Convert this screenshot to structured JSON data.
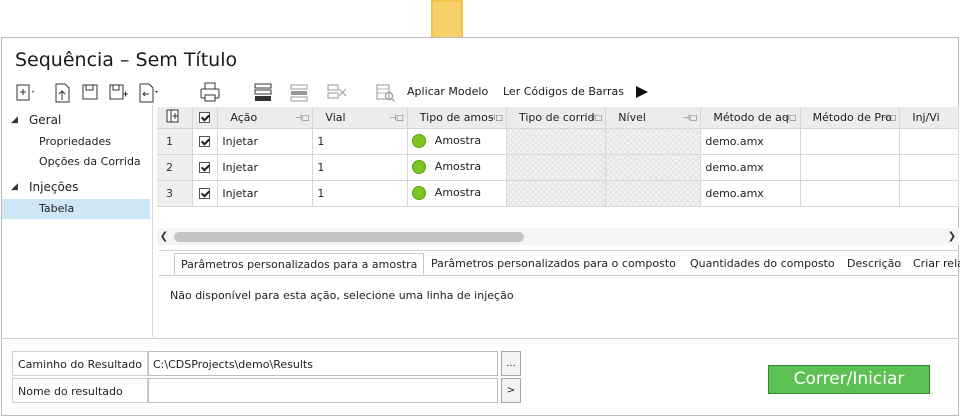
{
  "window": {
    "title": "Sequência – Sem Título"
  },
  "toolbar": {
    "apply_template": "Aplicar Modelo",
    "read_barcodes": "Ler Códigos de Barras"
  },
  "nav": {
    "groups": [
      {
        "label": "Geral",
        "items": [
          "Propriedades",
          "Opções da Corrida"
        ]
      },
      {
        "label": "Injeções",
        "items": [
          "Tabela"
        ]
      }
    ],
    "selected": "Tabela"
  },
  "grid": {
    "columns": [
      "Ação",
      "Vial",
      "Tipo de amos",
      "Tipo de corrid",
      "Nível",
      "Método de aq",
      "Método de Pro",
      "Inj/Vi"
    ],
    "rows": [
      {
        "num": "1",
        "checked": true,
        "action": "Injetar",
        "vial": "1",
        "sample_type": "Amostra",
        "method": "demo.amx"
      },
      {
        "num": "2",
        "checked": true,
        "action": "Injetar",
        "vial": "1",
        "sample_type": "Amostra",
        "method": "demo.amx"
      },
      {
        "num": "3",
        "checked": true,
        "action": "Injetar",
        "vial": "1",
        "sample_type": "Amostra",
        "method": "demo.amx"
      }
    ],
    "status_color": "#7cc521"
  },
  "tabs": {
    "items": [
      "Parâmetros personalizados para a amostra",
      "Parâmetros personalizados para o composto",
      "Quantidades do composto",
      "Descrição",
      "Criar rela"
    ],
    "active": 0,
    "message": "Não disponível para esta ação, selecione uma linha de injeção"
  },
  "result": {
    "path_label": "Caminho do Resultado",
    "path_value": "C:\\CDSProjects\\demo\\Results",
    "path_button": "...",
    "name_label": "Nome do resultado",
    "name_value": "",
    "name_button": ">"
  },
  "run_button": "Correr/Iniciar",
  "colors": {
    "accent_arrow": "#f7cd5d",
    "run_button": "#5cc152",
    "selection": "#cfe6f5"
  }
}
